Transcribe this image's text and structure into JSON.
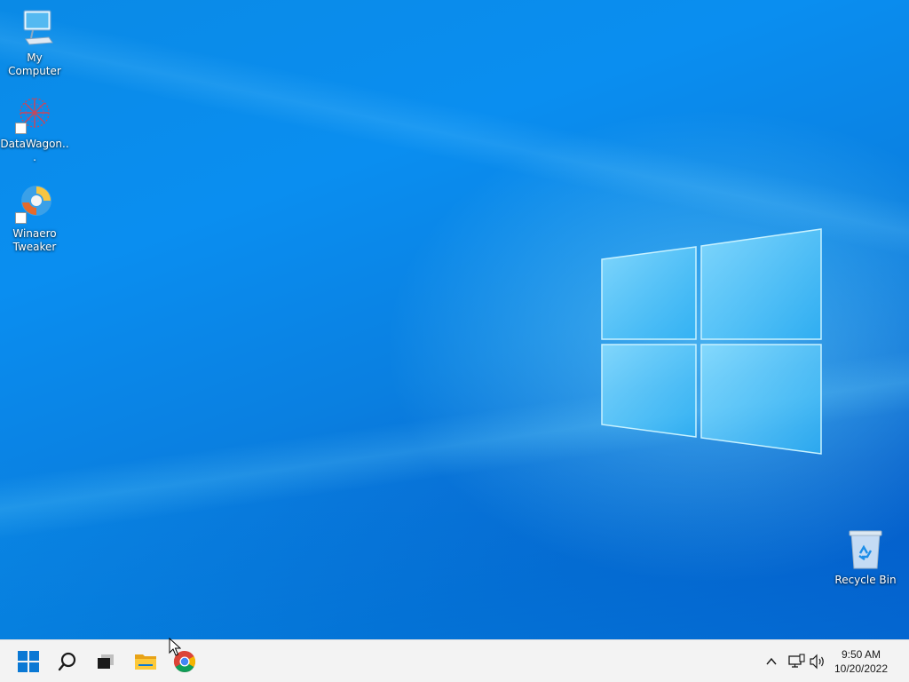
{
  "desktop": {
    "icons": [
      {
        "label": "My Computer",
        "icon": "computer-icon"
      },
      {
        "label": "DataWagon...",
        "icon": "datawagon-app-icon"
      },
      {
        "label": "Winaero Tweaker",
        "icon": "winaero-tweaker-icon"
      },
      {
        "label": "Recycle Bin",
        "icon": "recycle-bin-icon"
      }
    ],
    "wallpaper": "windows-logo-light-wallpaper"
  },
  "taskbar": {
    "pinned": [
      {
        "name": "Start",
        "icon": "windows-start-icon"
      },
      {
        "name": "Search",
        "icon": "search-icon"
      },
      {
        "name": "Task View",
        "icon": "task-view-icon"
      },
      {
        "name": "File Explorer",
        "icon": "folder-icon"
      },
      {
        "name": "Google Chrome",
        "icon": "chrome-icon"
      }
    ],
    "tray": {
      "icons": [
        "chevron-up-icon",
        "network-icon",
        "speaker-icon"
      ],
      "time": "9:50 AM",
      "date": "10/20/2022"
    }
  },
  "colors": {
    "accent": "#0078d7",
    "taskbar_bg": "#f3f3f3",
    "start_blue": "#0a78d4"
  }
}
